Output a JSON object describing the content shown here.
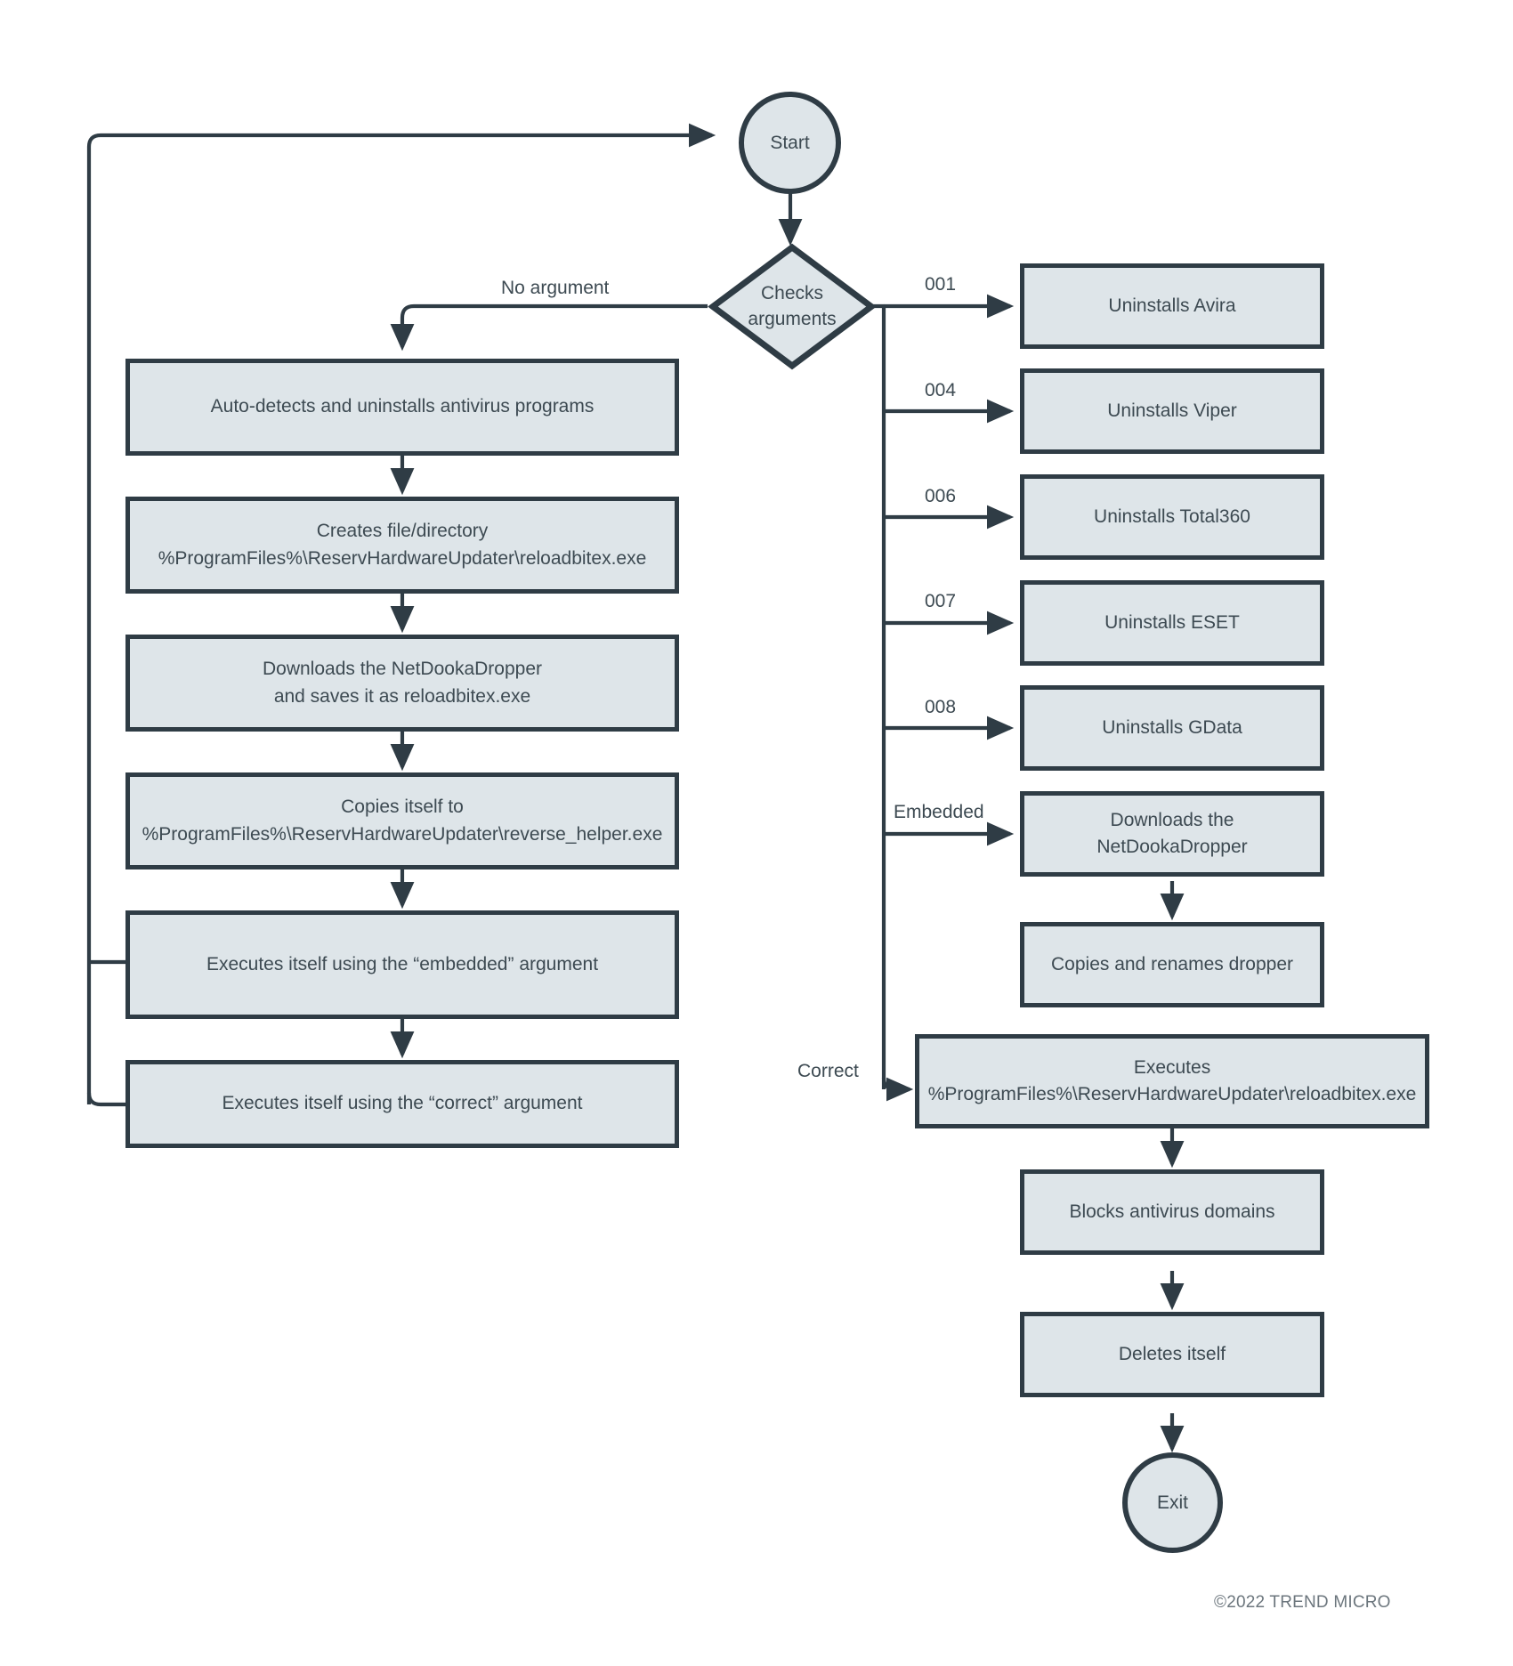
{
  "diagram": {
    "type": "flowchart",
    "title_visible": false,
    "colors": {
      "node_fill": "#dee5e9",
      "node_border": "#2f3c45",
      "text": "#3d4a52",
      "background": "#ffffff",
      "copyright_text": "#6c767d"
    },
    "terminators": {
      "start": "Start",
      "exit": "Exit"
    },
    "decision": {
      "label": "Checks\narguments"
    },
    "left_branch": {
      "entry_label": "No argument",
      "steps": [
        {
          "id": "auto-detects",
          "text": "Auto-detects and uninstalls antivirus programs"
        },
        {
          "id": "creates-file",
          "text": "Creates file/directory\n%ProgramFiles%\\ReservHardwareUpdater\\reloadbitex.exe"
        },
        {
          "id": "downloads-dropper",
          "text": "Downloads the NetDookaDropper\nand saves it as reloadbitex.exe"
        },
        {
          "id": "copies-itself",
          "text": "Copies itself to\n%ProgramFiles%\\ReservHardwareUpdater\\reverse_helper.exe"
        },
        {
          "id": "executes-embedded",
          "text": "Executes itself using the “embedded” argument"
        },
        {
          "id": "executes-correct",
          "text": "Executes itself using the “correct” argument"
        }
      ]
    },
    "right_branch": {
      "argument_routes": [
        {
          "label": "001",
          "text": "Uninstalls Avira"
        },
        {
          "label": "004",
          "text": "Uninstalls Viper"
        },
        {
          "label": "006",
          "text": "Uninstalls Total360"
        },
        {
          "label": "007",
          "text": "Uninstalls ESET"
        },
        {
          "label": "008",
          "text": "Uninstalls GData"
        },
        {
          "label": "Embedded",
          "text": "Downloads the NetDookaDropper"
        }
      ],
      "embedded_followup": {
        "id": "copies-renames",
        "text": "Copies and renames dropper"
      },
      "correct_route": {
        "label": "Correct",
        "text": "Executes\n%ProgramFiles%\\ReservHardwareUpdater\\reloadbitex.exe"
      },
      "post_steps": [
        {
          "id": "blocks-domains",
          "text": "Blocks antivirus domains"
        },
        {
          "id": "deletes-itself",
          "text": "Deletes itself"
        }
      ]
    },
    "footer": {
      "copyright": "©2022 TREND MICRO"
    }
  }
}
